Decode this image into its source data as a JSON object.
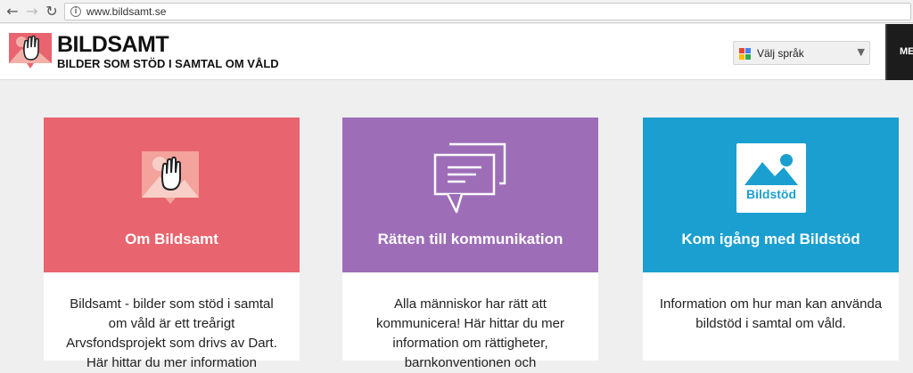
{
  "browser": {
    "url": "www.bildsamt.se"
  },
  "header": {
    "logo_title": "BILDSAMT",
    "logo_subtitle": "BILDER SOM STÖD I SAMTAL OM VÅLD",
    "language_label": "Välj språk",
    "menu_label": "ME"
  },
  "cards": [
    {
      "title": "Om Bildsamt",
      "text": "Bildsamt - bilder som stöd i samtal om våld är ett treårigt Arvsfondsprojekt som drivs av Dart. Här hittar du mer information",
      "color": "#e8646e",
      "icon": "hand-icon"
    },
    {
      "title": "Rätten till kommunikation",
      "text": "Alla människor har rätt att kommunicera! Här hittar du mer information om rättigheter, barnkonventionen och",
      "color": "#9e6db8",
      "icon": "chat-bubbles-icon"
    },
    {
      "title": "Kom igång med Bildstöd",
      "text": "Information om hur man kan använda bildstöd i samtal om våld.",
      "color": "#1b9fd0",
      "icon": "bildstod-icon",
      "icon_label": "Bildstöd"
    }
  ]
}
